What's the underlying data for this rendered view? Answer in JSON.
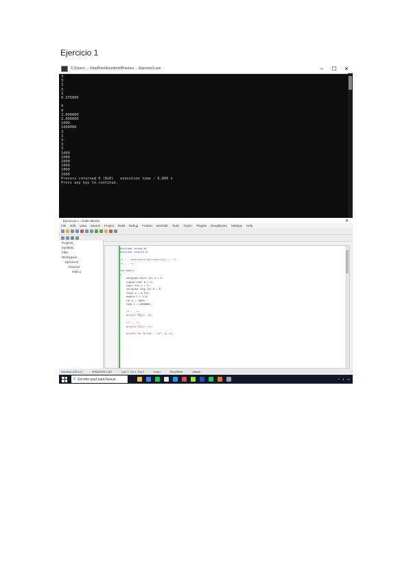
{
  "heading": "Ejercicio 1",
  "console": {
    "title": "C:\\Users\\ ... \\OneDrive\\Escritorio\\Practica ... \\Ejercicio1.exe",
    "lines": [
      "3",
      "3",
      "3",
      "3",
      "3",
      "0.375000",
      "",
      "4",
      "4",
      "3.000000",
      "3.000000",
      "1000",
      "1000000",
      "3",
      "3",
      "3",
      "3",
      "3",
      "1000",
      "1000",
      "1000",
      "1000",
      "1000",
      "1000",
      "Process returned 0 (0x0)   execution time : 6.605 s",
      "Press any key to continue."
    ]
  },
  "ide": {
    "title": "Ejercicio1.c - Code::Blocks",
    "menu": [
      "File",
      "Edit",
      "View",
      "Search",
      "Project",
      "Build",
      "Debug",
      "Fortran",
      "wxSmith",
      "Tools",
      "Tools+",
      "Plugins",
      "DoxyBlocks",
      "Settings",
      "Help"
    ],
    "sidebar": [
      "Projects",
      "Symbols",
      "Files",
      "Workspace",
      "Ejercicio1",
      "Sources",
      "main.c"
    ],
    "code_lines": [
      {
        "cls": "kw",
        "text": "#include <stdio.h>"
      },
      {
        "cls": "kw",
        "text": "#include <stdlib.h>"
      },
      {
        "cls": "",
        "text": ""
      },
      {
        "cls": "cm",
        "text": "/* ... comentario del ejercicio ... */"
      },
      {
        "cls": "cm",
        "text": "/* ... */"
      },
      {
        "cls": "",
        "text": ""
      },
      {
        "cls": "kw",
        "text": "int main()"
      },
      {
        "cls": "",
        "text": "{"
      },
      {
        "cls": "",
        "text": "    unsigned short int a = 3;"
      },
      {
        "cls": "",
        "text": "    signed char b = 3;"
      },
      {
        "cls": "",
        "text": "    short int c = 3;"
      },
      {
        "cls": "",
        "text": "    unsigned long int d = 3;"
      },
      {
        "cls": "",
        "text": "    float e = 0.375;"
      },
      {
        "cls": "",
        "text": "    double f = 3.0;"
      },
      {
        "cls": "",
        "text": "    int g = 1000;"
      },
      {
        "cls": "",
        "text": "    long h = 1000000;"
      },
      {
        "cls": "",
        "text": ""
      },
      {
        "cls": "cm",
        "text": "    /* ... */"
      },
      {
        "cls": "st",
        "text": "    printf(\"%d\\n\", a);"
      },
      {
        "cls": "",
        "text": ""
      },
      {
        "cls": "cm",
        "text": "    /* ... */"
      },
      {
        "cls": "st",
        "text": "    printf(\"%f\\n\", e);"
      },
      {
        "cls": "",
        "text": ""
      },
      {
        "cls": "st",
        "text": "    printf(\"%d %d %ld ...\\n\", g, h);"
      }
    ],
    "status": [
      "Windows (CR+LF)",
      "WINDOWS-1252",
      "Line 1, Col 1, Pos 0",
      "Insert",
      "Read/Write",
      "default"
    ]
  },
  "taskbar": {
    "search_placeholder": "Escribe aquí para buscar",
    "app_colors": [
      "#f2c14e",
      "#3b82f6",
      "#22c55e",
      "#e5e7eb",
      "#0ea5e9",
      "#ef4444",
      "#a3e635",
      "#1d4ed8",
      "#22c55e",
      "#f97316",
      "#9ca3af"
    ]
  }
}
